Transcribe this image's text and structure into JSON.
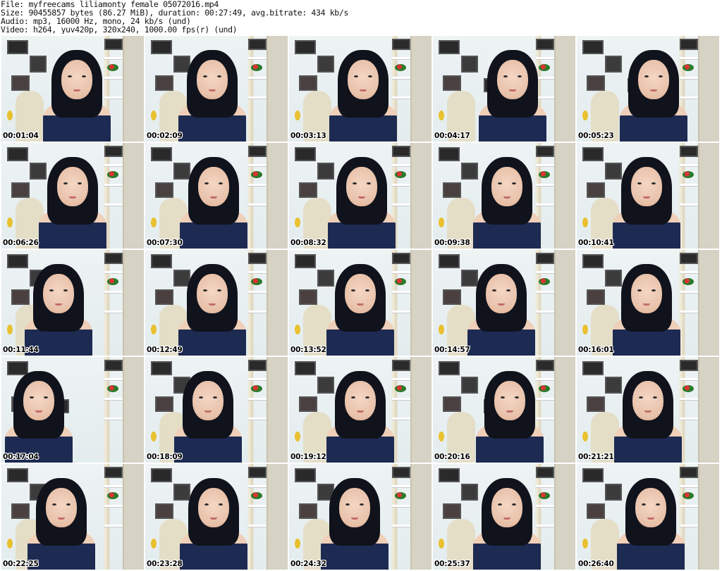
{
  "header": {
    "file_line": "File: myfreecams_liliamonty_female_05072016.mp4",
    "size_line": "Size: 90455857 bytes (86.27 MiB), duration: 00:27:49, avg.bitrate: 434 kb/s",
    "audio_line": "Audio: mp3, 16000 Hz, mono, 24 kb/s (und)",
    "video_line": "Video: h264, yuv420p, 320x240, 1000.00 fps(r) (und)"
  },
  "thumbnails": [
    {
      "timestamp": "00:01:04"
    },
    {
      "timestamp": "00:02:09"
    },
    {
      "timestamp": "00:03:13"
    },
    {
      "timestamp": "00:04:17"
    },
    {
      "timestamp": "00:05:23"
    },
    {
      "timestamp": "00:06:26"
    },
    {
      "timestamp": "00:07:30"
    },
    {
      "timestamp": "00:08:32"
    },
    {
      "timestamp": "00:09:38"
    },
    {
      "timestamp": "00:10:41"
    },
    {
      "timestamp": "00:11:44"
    },
    {
      "timestamp": "00:12:49"
    },
    {
      "timestamp": "00:13:52"
    },
    {
      "timestamp": "00:14:57"
    },
    {
      "timestamp": "00:16:01"
    },
    {
      "timestamp": "00:17:04"
    },
    {
      "timestamp": "00:18:09"
    },
    {
      "timestamp": "00:19:12"
    },
    {
      "timestamp": "00:20:16"
    },
    {
      "timestamp": "00:21:21"
    },
    {
      "timestamp": "00:22:25"
    },
    {
      "timestamp": "00:23:28"
    },
    {
      "timestamp": "00:24:32"
    },
    {
      "timestamp": "00:25:37"
    },
    {
      "timestamp": "00:26:40"
    }
  ],
  "colors": {
    "background": "#ffffff",
    "text": "#111111",
    "top_color": "#1d2a52",
    "hair_color": "#10131c"
  }
}
